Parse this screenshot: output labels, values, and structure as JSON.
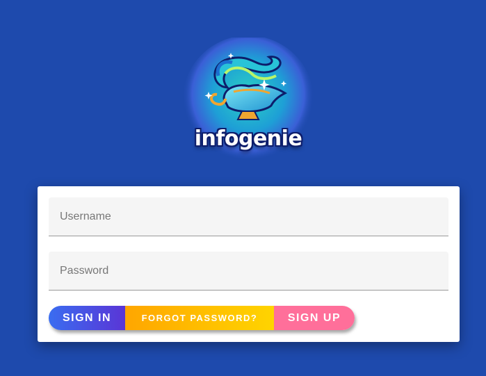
{
  "logo": {
    "text": "infogenie"
  },
  "login": {
    "username_placeholder": "Username",
    "password_placeholder": "Password",
    "sign_in_label": "SIGN IN",
    "forgot_label": "FORGOT PASSWORD?",
    "sign_up_label": "SIGN UP"
  },
  "colors": {
    "background": "#1e4aad",
    "card": "#ffffff",
    "sign_in": "#4a55e3",
    "forgot": "#ffbb00",
    "sign_up": "#ff6f9a"
  }
}
